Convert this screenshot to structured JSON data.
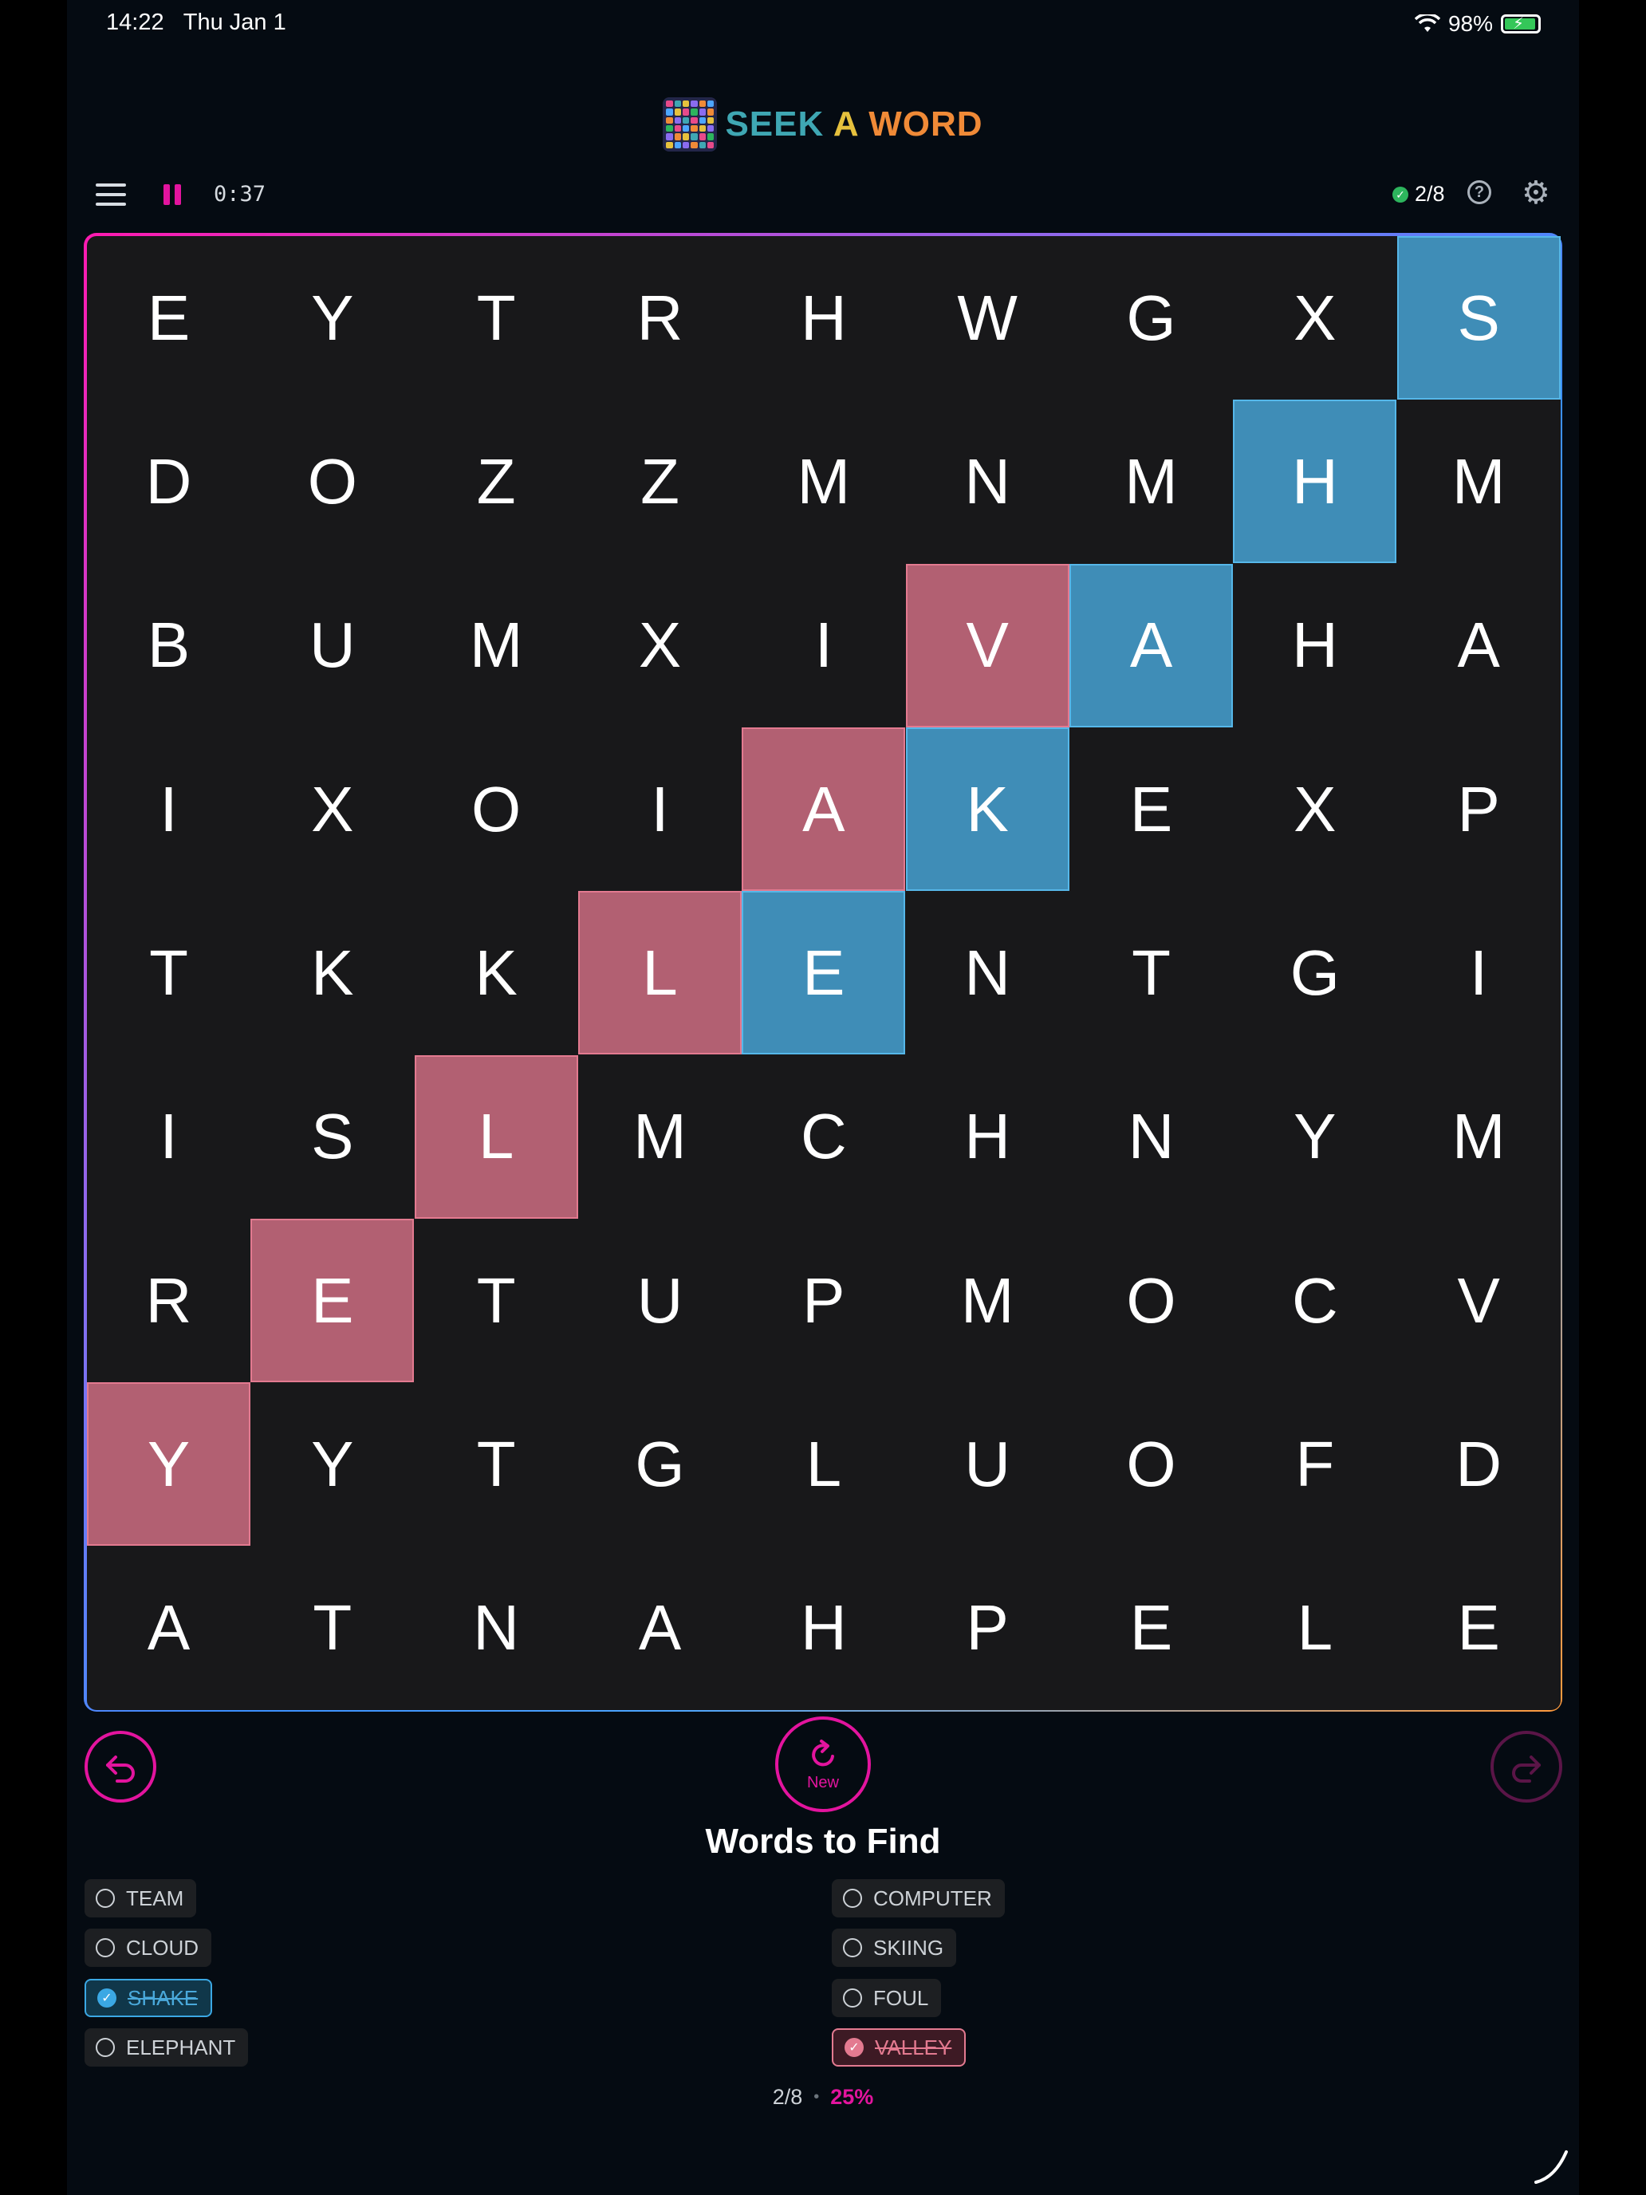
{
  "status": {
    "time": "14:22",
    "date": "Thu Jan 1",
    "battery": "98%"
  },
  "title": {
    "seek": "SEEK",
    "a": "A",
    "word": "WORD"
  },
  "toolbar": {
    "timer": "0:37",
    "progress": "2/8",
    "help": "?"
  },
  "grid": [
    [
      "E",
      "Y",
      "T",
      "R",
      "H",
      "W",
      "G",
      "X",
      "S"
    ],
    [
      "D",
      "O",
      "Z",
      "Z",
      "M",
      "N",
      "M",
      "H",
      "M"
    ],
    [
      "B",
      "U",
      "M",
      "X",
      "I",
      "V",
      "A",
      "H",
      "A"
    ],
    [
      "I",
      "X",
      "O",
      "I",
      "A",
      "K",
      "E",
      "X",
      "P"
    ],
    [
      "T",
      "K",
      "K",
      "L",
      "E",
      "N",
      "T",
      "G",
      "I"
    ],
    [
      "I",
      "S",
      "L",
      "M",
      "C",
      "H",
      "N",
      "Y",
      "M"
    ],
    [
      "R",
      "E",
      "T",
      "U",
      "P",
      "M",
      "O",
      "C",
      "V"
    ],
    [
      "Y",
      "Y",
      "T",
      "G",
      "L",
      "U",
      "O",
      "F",
      "D"
    ],
    [
      "A",
      "T",
      "N",
      "A",
      "H",
      "P",
      "E",
      "L",
      "E"
    ]
  ],
  "highlights": {
    "SHAKE": {
      "color": "#3f8db7",
      "cells": [
        [
          0,
          8
        ],
        [
          1,
          7
        ],
        [
          2,
          6
        ],
        [
          3,
          5
        ],
        [
          4,
          4
        ]
      ]
    },
    "VALLEY": {
      "color": "#b26072",
      "cells": [
        [
          2,
          5
        ],
        [
          3,
          4
        ],
        [
          4,
          3
        ],
        [
          5,
          2
        ],
        [
          6,
          1
        ],
        [
          7,
          0
        ]
      ]
    }
  },
  "controls": {
    "new_label": "New"
  },
  "words_title": "Words to Find",
  "words": {
    "left": [
      {
        "label": "TEAM",
        "found": false
      },
      {
        "label": "CLOUD",
        "found": false
      },
      {
        "label": "SHAKE",
        "found": true,
        "style": "blue"
      },
      {
        "label": "ELEPHANT",
        "found": false
      }
    ],
    "right": [
      {
        "label": "COMPUTER",
        "found": false
      },
      {
        "label": "SKIING",
        "found": false
      },
      {
        "label": "FOUL",
        "found": false
      },
      {
        "label": "VALLEY",
        "found": true,
        "style": "red"
      }
    ]
  },
  "footer": {
    "count": "2/8",
    "percent": "25%"
  }
}
